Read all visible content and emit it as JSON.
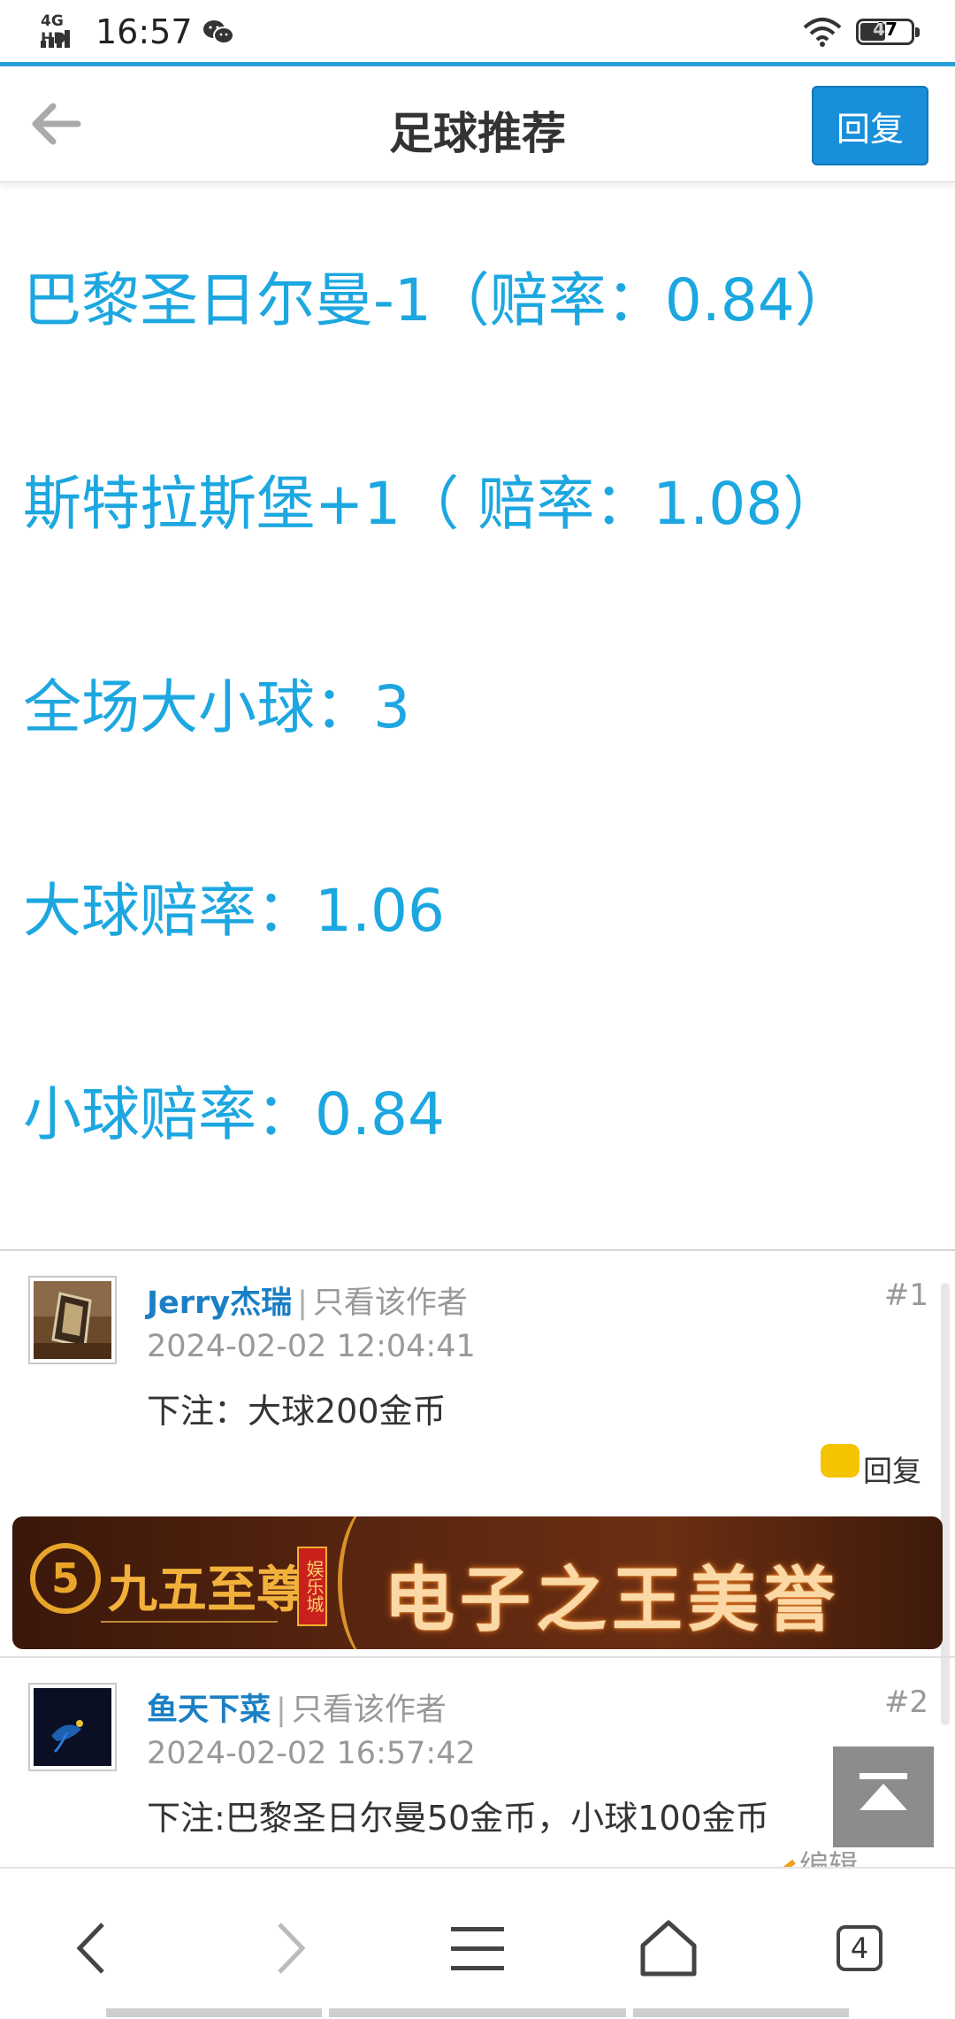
{
  "status_bar": {
    "network": "4G HD",
    "time": "16:57",
    "battery_level": "47"
  },
  "header": {
    "title": "足球推荐",
    "reply_label": "回复"
  },
  "post": {
    "lines": [
      "巴黎圣日尔曼-1（赔率：0.84）",
      "斯特拉斯堡+1（ 赔率：1.08）",
      "全场大小球：3",
      "大球赔率：1.06",
      "小球赔率：0.84"
    ]
  },
  "comments": [
    {
      "author": "Jerry杰瑞",
      "separator": "|",
      "only_author": "只看该作者",
      "floor": "#1",
      "time": "2024-02-02 12:04:41",
      "body": "下注：大球200金币",
      "reply_label": "回复"
    },
    {
      "author": "鱼天下菜",
      "separator": "|",
      "only_author": "只看该作者",
      "floor": "#2",
      "time": "2024-02-02 16:57:42",
      "body": "下注:巴黎圣日尔曼50金币，小球100金币",
      "edit_label": "编辑"
    }
  ],
  "ad": {
    "logo_char": "5",
    "brand": "九五至尊",
    "badge": "娱乐城",
    "slogan": "电子之王美誉"
  },
  "nav": {
    "tab_count": "4"
  },
  "colors": {
    "accent": "#1da7e0",
    "reply_button": "#1a8fd9",
    "author_link": "#1a7fc4"
  }
}
